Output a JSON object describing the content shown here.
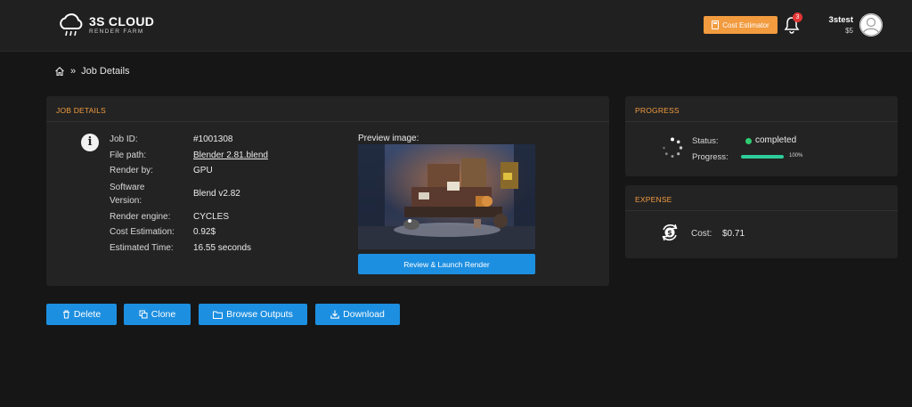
{
  "header": {
    "logo_main": "3S CLOUD",
    "logo_sub": "RENDER FARM",
    "cost_estimator_label": "Cost Estimator",
    "notification_count": "3",
    "user_name": "3stest",
    "user_balance": "$5"
  },
  "breadcrumb": {
    "separator": "»",
    "current": "Job Details"
  },
  "job_details": {
    "title": "JOB DETAILS",
    "fields": [
      {
        "label": "Job ID:",
        "value": "#1001308"
      },
      {
        "label": "File path:",
        "value": "Blender 2.81.blend"
      },
      {
        "label": "Render by:",
        "value": "GPU"
      },
      {
        "label": "Software",
        "label2": "Version:",
        "value": "Blend v2.82"
      },
      {
        "label": "Render engine:",
        "value": "CYCLES"
      },
      {
        "label": "Cost Estimation:",
        "value": "0.92$"
      },
      {
        "label": "Estimated Time:",
        "value": "16.55 seconds"
      }
    ],
    "preview_label": "Preview image:",
    "review_button": "Review & Launch Render"
  },
  "progress": {
    "title": "PROGRESS",
    "status_label": "Status:",
    "status_value": "completed",
    "status_color": "#2ecc71",
    "progress_label": "Progress:",
    "progress_percent": 100,
    "progress_text": "100%"
  },
  "expense": {
    "title": "EXPENSE",
    "cost_label": "Cost:",
    "cost_value": "$0.71"
  },
  "actions": {
    "delete": "Delete",
    "clone": "Clone",
    "browse_outputs": "Browse Outputs",
    "download": "Download"
  },
  "colors": {
    "accent_blue": "#1d8fe1",
    "accent_orange": "#f29b3f",
    "background": "#161616",
    "panel": "#232323"
  }
}
